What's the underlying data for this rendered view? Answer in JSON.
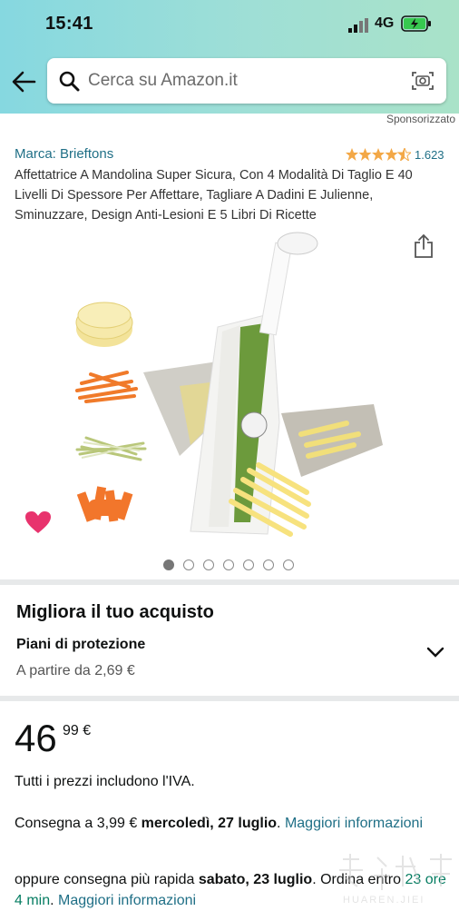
{
  "status_bar": {
    "time": "15:41",
    "network": "4G"
  },
  "search": {
    "placeholder": "Cerca su Amazon.it"
  },
  "product": {
    "sponsored_label": "Sponsorizzato",
    "brand": "Marca: Brieftons",
    "rating_stars": 4.5,
    "rating_count": "1.623",
    "title": "Affettatrice A Mandolina Super Sicura, Con 4 Modalità Di Taglio E 40 Livelli Di Spessore Per Affettare, Tagliare A Dadini E Julienne, Sminuzzare, Design Anti-Lesioni E 5 Libri Di Ricette",
    "image_count": 7,
    "active_image": 1
  },
  "upgrade": {
    "title": "Migliora il tuo acquisto",
    "plan_label": "Piani di protezione",
    "plan_price": "A partire da 2,69 €"
  },
  "price": {
    "whole": "46",
    "fraction": "99 €",
    "tax_note": "Tutti i prezzi includono l'IVA."
  },
  "delivery": {
    "line1_prefix": "Consegna a 3,99 € ",
    "line1_date": "mercoledì, 27 luglio",
    "line1_sep": ". ",
    "line1_link": "Maggiori informazioni",
    "line2_prefix": "oppure consegna più rapida ",
    "line2_date": "sabato, 23 luglio",
    "line2_mid": ". Ordina entro ",
    "line2_time": "23 ore 4 min",
    "line2_sep": ". ",
    "line2_link": "Maggiori informazioni"
  },
  "watermark": {
    "text": "HUAREN.JIEI"
  },
  "colors": {
    "link": "#1f6f86",
    "star": "#f3a847",
    "heart": "#e8336d",
    "green": "#067d62"
  }
}
